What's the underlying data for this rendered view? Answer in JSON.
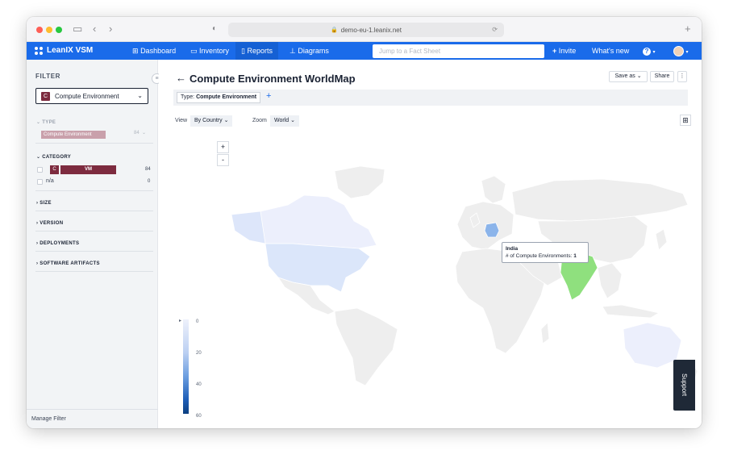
{
  "browser": {
    "url": "demo-eu-1.leanix.net"
  },
  "nav": {
    "logo_label": "LeanIX VSM",
    "items": [
      {
        "icon": "grid-icon",
        "label": "Dashboard"
      },
      {
        "icon": "box-icon",
        "label": "Inventory"
      },
      {
        "icon": "bar-chart-icon",
        "label": "Reports"
      },
      {
        "icon": "sitemap-icon",
        "label": "Diagrams"
      }
    ],
    "search_placeholder": "Jump to a Fact Sheet",
    "invite_label": "Invite",
    "whats_new_label": "What's new",
    "help_label": "?"
  },
  "sidebar": {
    "title": "FILTER",
    "fact_sheet_type": {
      "badge": "C",
      "label": "Compute Environment"
    },
    "type_section": {
      "label": "TYPE",
      "chip": "Compute Environment",
      "count": "84"
    },
    "category_section": {
      "label": "CATEGORY",
      "rows": [
        {
          "badge": "C",
          "label": "VM",
          "count": "84"
        },
        {
          "badge": "",
          "label": "n/a",
          "count": "0"
        }
      ]
    },
    "sections": [
      "SIZE",
      "VERSION",
      "DEPLOYMENTS",
      "SOFTWARE ARTIFACTS"
    ],
    "manage_label": "Manage Filter"
  },
  "main": {
    "title": "Compute Environment WorldMap",
    "save_as_label": "Save as",
    "share_label": "Share",
    "filter_chip": {
      "key": "Type:",
      "value": "Compute Environment"
    },
    "view": {
      "label": "View",
      "value": "By Country"
    },
    "zoom": {
      "label": "Zoom",
      "value": "World"
    },
    "zoom_in": "+",
    "zoom_out": "-",
    "legend": [
      "0",
      "20",
      "40",
      "60"
    ],
    "tooltip": {
      "country": "India",
      "metric": "# of Compute Environments:",
      "value": "1"
    },
    "support_label": "Support"
  },
  "colors": {
    "nav_blue": "#1a6bea",
    "category_vm": "#7d2b3f",
    "india_highlight": "#8fe07e",
    "germany": "#8bb4ea",
    "usa": "#dbe6fa",
    "light_blue": "#eceffc"
  }
}
